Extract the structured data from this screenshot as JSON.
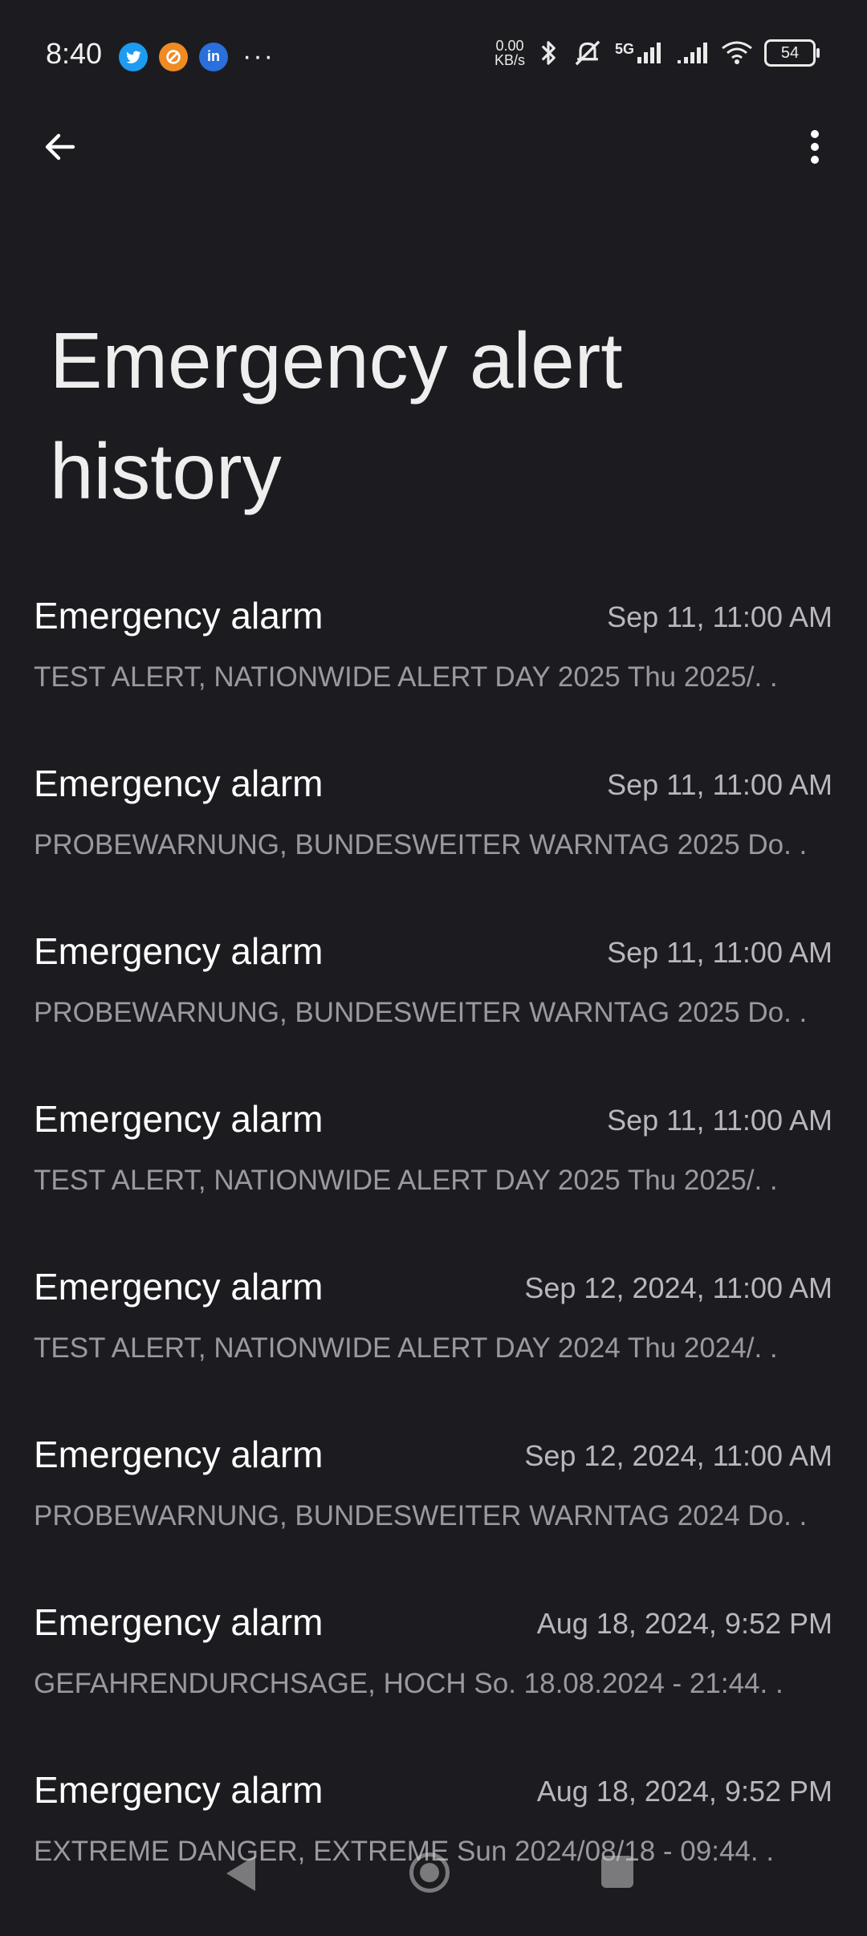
{
  "status_bar": {
    "time": "8:40",
    "notification_icons": [
      {
        "name": "twitter-icon",
        "glyph": "t",
        "color": "#1d9bf0"
      },
      {
        "name": "halo-app-icon",
        "glyph": "⊘",
        "color": "#f08a24"
      },
      {
        "name": "linkedin-icon",
        "glyph": "in",
        "color": "#2a6fdb"
      }
    ],
    "more": "···",
    "net_speed_value": "0.00",
    "net_speed_unit": "KB/s",
    "network": "5G",
    "battery": "54"
  },
  "page": {
    "title": "Emergency alert history"
  },
  "alerts": [
    {
      "title": "Emergency alarm",
      "date": "Sep 11, 11:00 AM",
      "body": "TEST ALERT, NATIONWIDE ALERT DAY 2025 Thu 2025/. ."
    },
    {
      "title": "Emergency alarm",
      "date": "Sep 11, 11:00 AM",
      "body": "PROBEWARNUNG, BUNDESWEITER WARNTAG 2025 Do. ."
    },
    {
      "title": "Emergency alarm",
      "date": "Sep 11, 11:00 AM",
      "body": "PROBEWARNUNG, BUNDESWEITER WARNTAG 2025 Do. ."
    },
    {
      "title": "Emergency alarm",
      "date": "Sep 11, 11:00 AM",
      "body": "TEST ALERT, NATIONWIDE ALERT DAY 2025 Thu 2025/. ."
    },
    {
      "title": "Emergency alarm",
      "date": "Sep 12, 2024, 11:00 AM",
      "body": "TEST ALERT, NATIONWIDE ALERT DAY 2024 Thu 2024/. ."
    },
    {
      "title": "Emergency alarm",
      "date": "Sep 12, 2024, 11:00 AM",
      "body": "PROBEWARNUNG, BUNDESWEITER WARNTAG 2024 Do. ."
    },
    {
      "title": "Emergency alarm",
      "date": "Aug 18, 2024, 9:52 PM",
      "body": "GEFAHRENDURCHSAGE, HOCH So. 18.08.2024 - 21:44. ."
    },
    {
      "title": "Emergency alarm",
      "date": "Aug 18, 2024, 9:52 PM",
      "body": "EXTREME DANGER, EXTREME Sun 2024/08/18 - 09:44. ."
    }
  ],
  "icons": {
    "back": "back-arrow-icon",
    "menu": "more-vert-icon"
  }
}
